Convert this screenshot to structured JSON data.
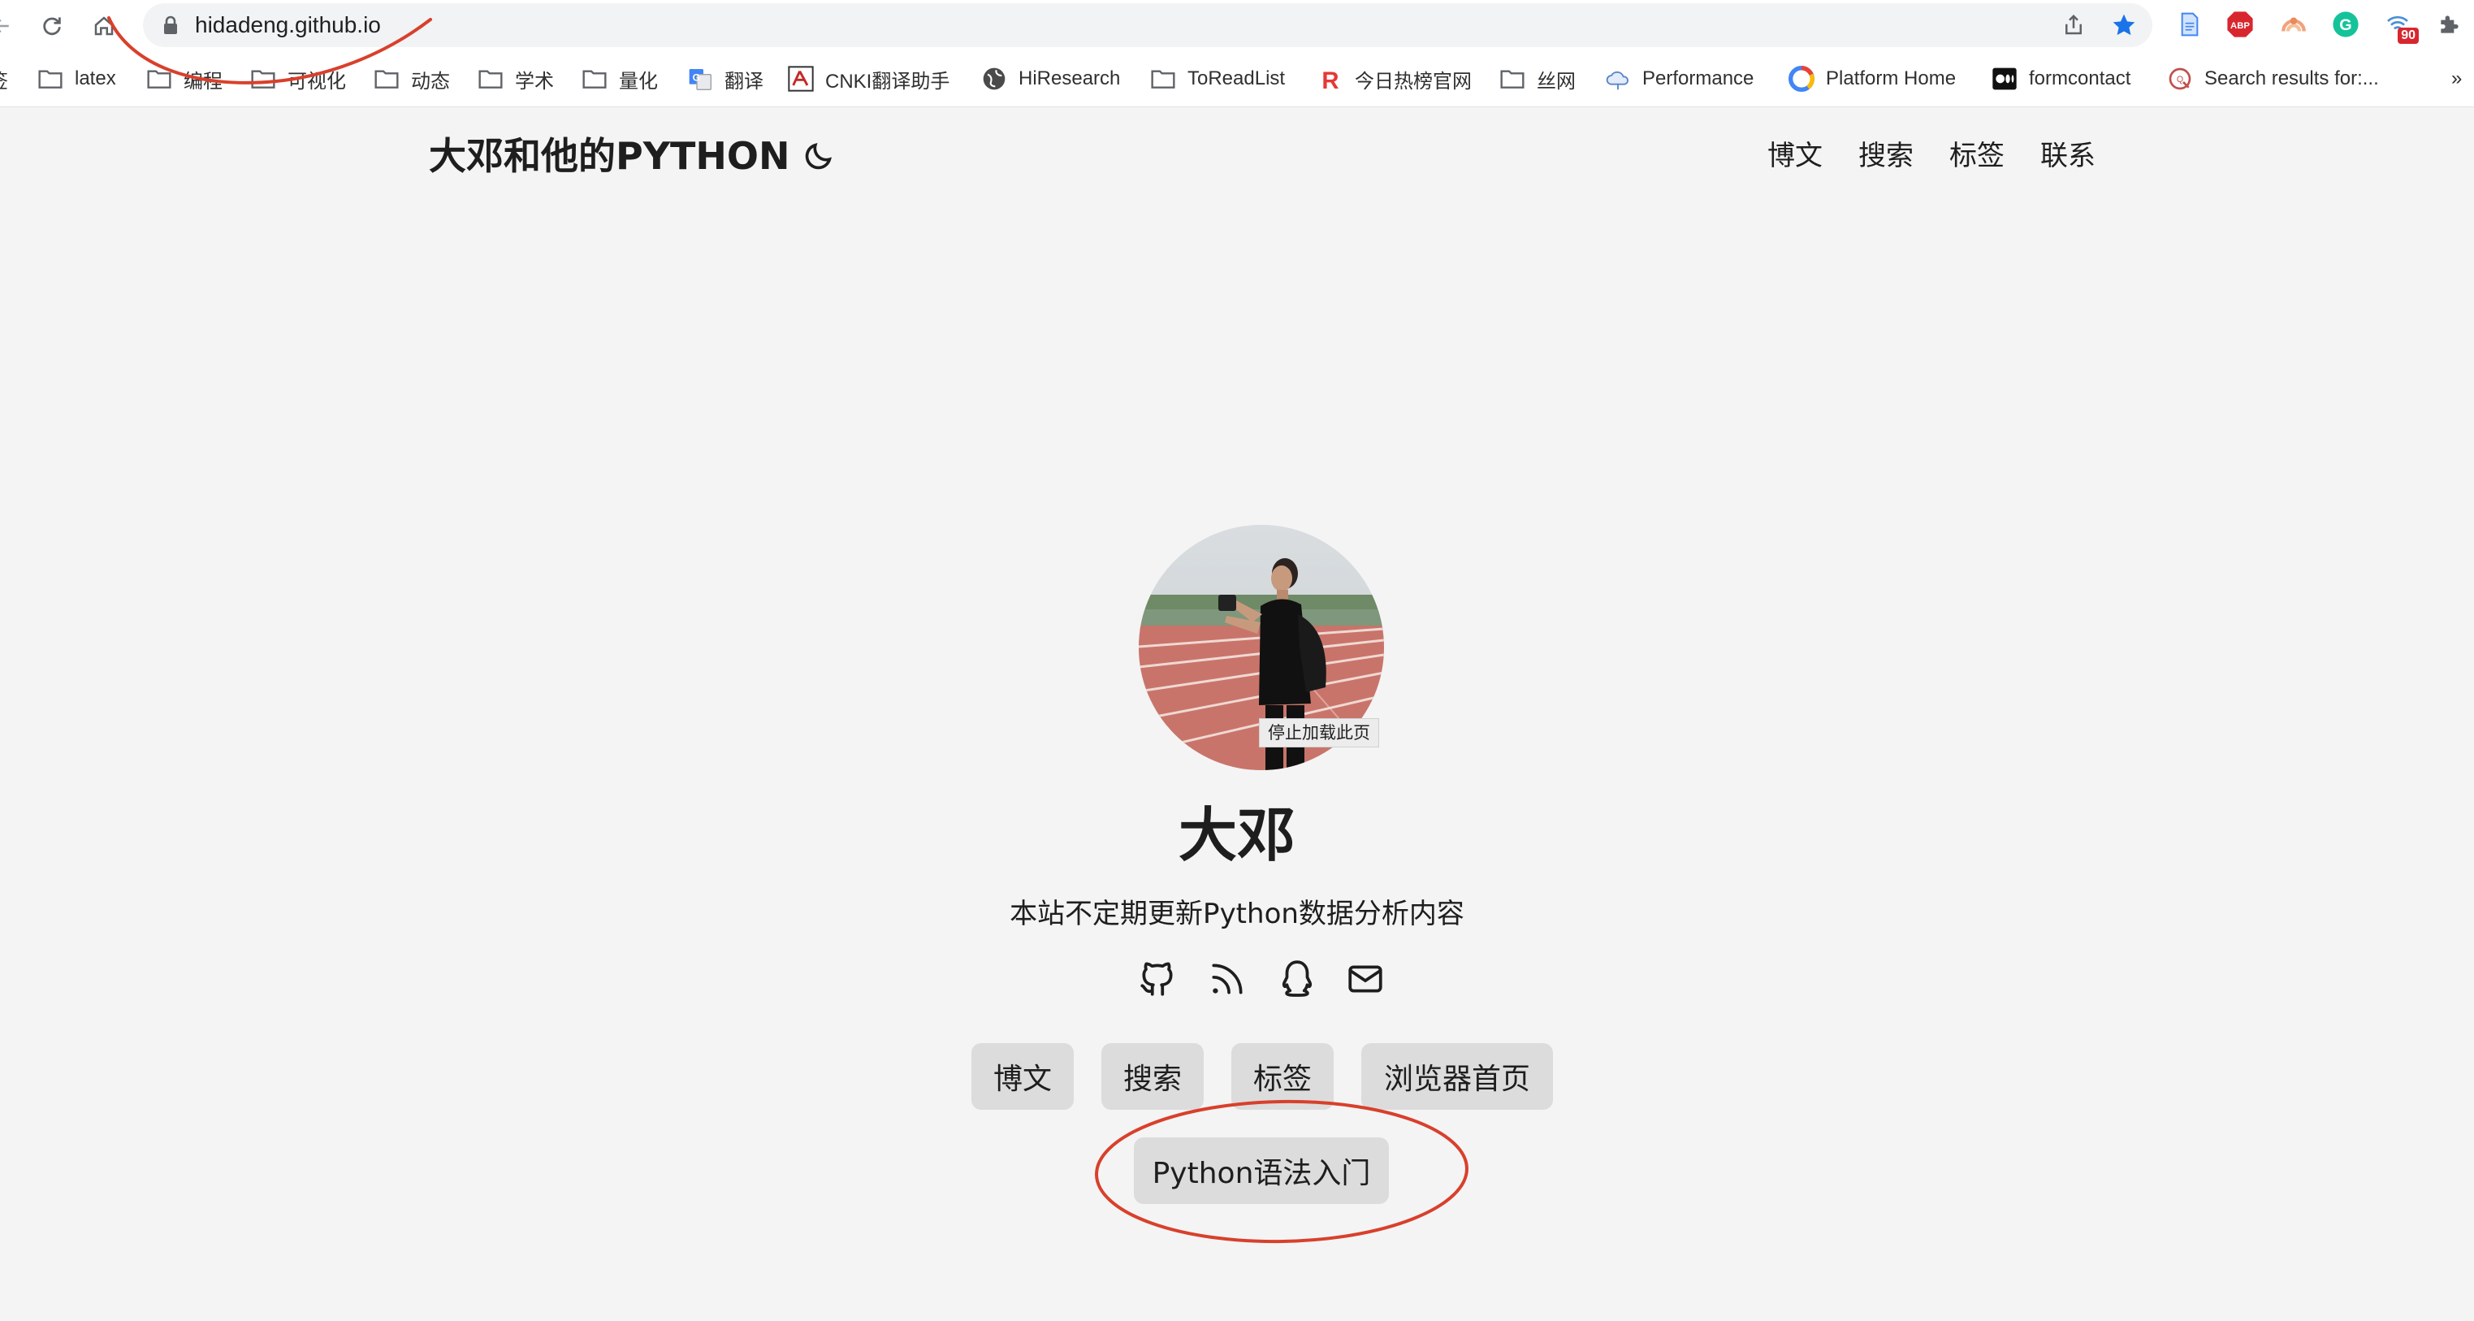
{
  "browser": {
    "url": "hidadeng.github.io",
    "icons": [
      "back-icon",
      "reload-icon",
      "home-icon",
      "lock-icon",
      "share-icon",
      "bookmark-star-icon"
    ],
    "extensions": [
      {
        "name": "docs-extension-icon"
      },
      {
        "name": "adblock-plus-icon",
        "label": "ABP"
      },
      {
        "name": "rainbow-extension-icon"
      },
      {
        "name": "grammarly-icon",
        "label": "G"
      },
      {
        "name": "wifi-extension-icon",
        "badge": "90"
      },
      {
        "name": "extensions-puzzle-icon"
      }
    ]
  },
  "bookmarks": {
    "partial_label": "签",
    "items": [
      {
        "label": "latex",
        "icon": "folder-icon"
      },
      {
        "label": "编程",
        "icon": "folder-icon"
      },
      {
        "label": "可视化",
        "icon": "folder-icon"
      },
      {
        "label": "动态",
        "icon": "folder-icon"
      },
      {
        "label": "学术",
        "icon": "folder-icon"
      },
      {
        "label": "量化",
        "icon": "folder-icon"
      },
      {
        "label": "翻译",
        "icon": "google-translate-icon"
      },
      {
        "label": "CNKI翻译助手",
        "icon": "cnki-icon"
      },
      {
        "label": "HiResearch",
        "icon": "globe-icon"
      },
      {
        "label": "ToReadList",
        "icon": "folder-icon"
      },
      {
        "label": "今日热榜官网",
        "icon": "rebang-icon"
      },
      {
        "label": "丝网",
        "icon": "folder-icon"
      },
      {
        "label": "Performance",
        "icon": "cloud-icon"
      },
      {
        "label": "Platform Home",
        "icon": "platform-icon"
      },
      {
        "label": "formcontact",
        "icon": "medium-icon"
      },
      {
        "label": "Search results for:...",
        "icon": "quanty-icon"
      }
    ],
    "overflow": "»"
  },
  "site": {
    "title": "大邓和他的PYTHON",
    "nav": [
      "博文",
      "搜索",
      "标签",
      "联系"
    ]
  },
  "profile": {
    "tooltip": "停止加载此页",
    "name": "大邓",
    "tagline": "本站不定期更新Python数据分析内容",
    "social": [
      "github-icon",
      "rss-icon",
      "qq-icon",
      "mail-icon"
    ],
    "buttons": [
      "博文",
      "搜索",
      "标签",
      "浏览器首页"
    ],
    "featured_button": "Python语法入门"
  },
  "colors": {
    "page_bg": "#f4f4f4",
    "button_bg": "#dcdcdc",
    "annotation_red": "#d8402c"
  }
}
